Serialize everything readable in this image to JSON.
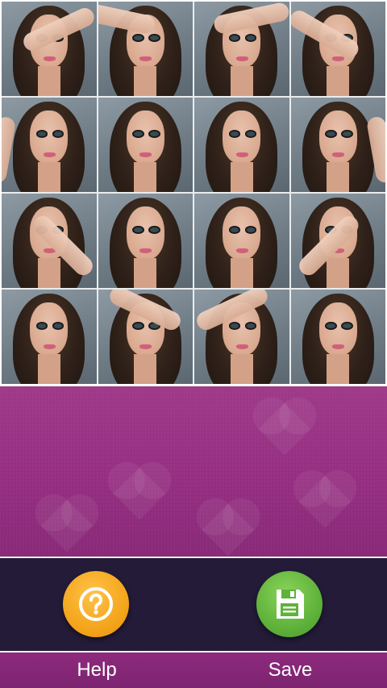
{
  "collage": {
    "tile_count": 16,
    "subject": "portrait-photo"
  },
  "toolbar": {
    "help_label": "Help",
    "save_label": "Save",
    "help_icon": "question-mark-icon",
    "save_icon": "floppy-disk-icon"
  },
  "colors": {
    "banner_purple": "#962f82",
    "toolbar_dark": "#231b37",
    "label_strip_purple": "#8e2a7d",
    "help_orange": "#f4a61c",
    "save_green": "#5fb23a"
  }
}
